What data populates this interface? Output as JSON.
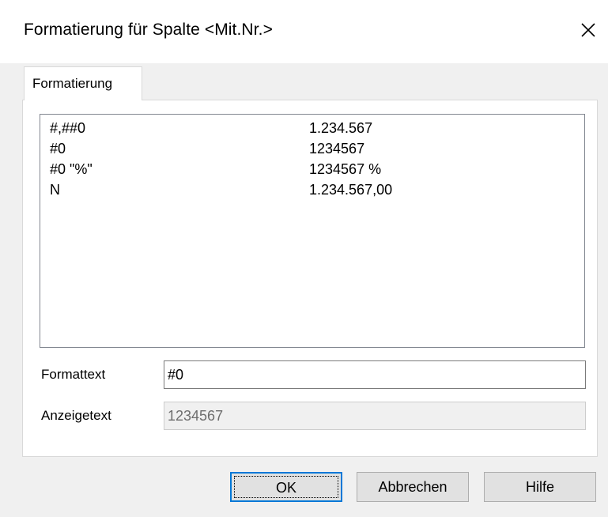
{
  "window": {
    "title": "Formatierung für Spalte <Mit.Nr.>"
  },
  "tabs": [
    {
      "label": "Formatierung",
      "selected": true
    }
  ],
  "format_list": {
    "rows": [
      {
        "format": "#,##0",
        "display": "1.234.567"
      },
      {
        "format": "#0",
        "display": "1234567"
      },
      {
        "format": "#0 \"%\"",
        "display": "1234567 %"
      },
      {
        "format": "N",
        "display": "1.234.567,00"
      }
    ]
  },
  "form": {
    "formattext_label": "Formattext",
    "formattext_value": "#0",
    "anzeigetext_label": "Anzeigetext",
    "anzeigetext_value": "1234567"
  },
  "buttons": {
    "ok_label": "OK",
    "cancel_label": "Abbrechen",
    "help_label": "Hilfe"
  },
  "colors": {
    "accent": "#0078d7",
    "window_bg": "#f0f0f0",
    "panel_bg": "#ffffff"
  },
  "icons": {
    "close": "close-icon"
  }
}
